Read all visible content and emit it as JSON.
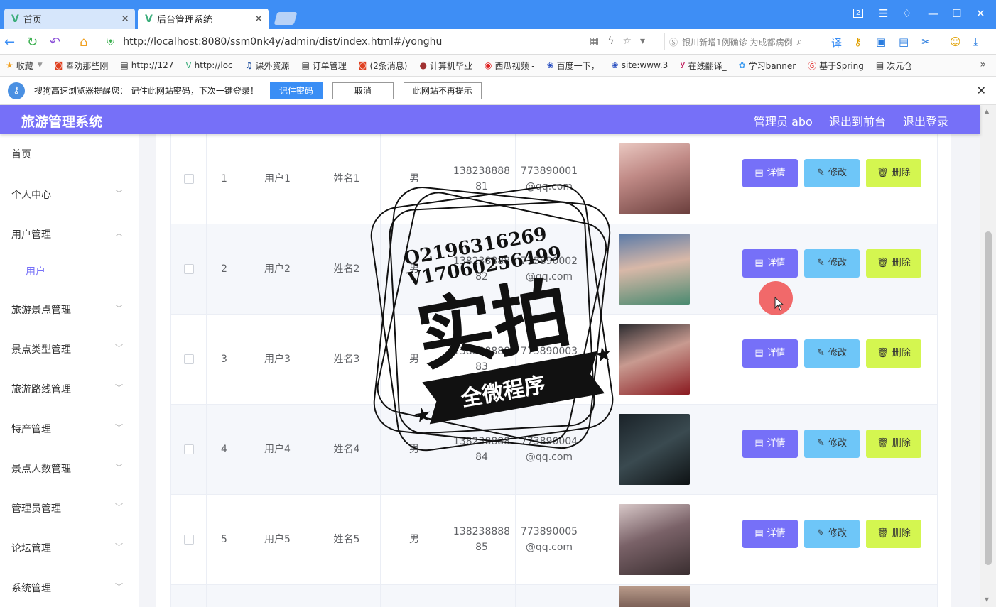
{
  "browser": {
    "tabs": [
      {
        "label": "首页",
        "active": false
      },
      {
        "label": "后台管理系统",
        "active": true
      }
    ],
    "window_badge": "2",
    "url": "http://localhost:8080/ssm0nk4y/admin/dist/index.html#/yonghu",
    "search_text": "银川新增1例确诊 为成都病例",
    "bookmarks": [
      "收藏",
      "奉劝那些刚",
      "http://127",
      "http://loc",
      "课外资源",
      "订单管理",
      "(2条消息)",
      "计算机毕业",
      "西瓜视频 -",
      "百度一下，",
      "site:www.3",
      "在线翻译_",
      "学习banner",
      "基于Spring",
      "次元仓"
    ],
    "password_prompt": {
      "text": "搜狗高速浏览器提醒您： 记住此网站密码，下次一键登录！",
      "remember": "记住密码",
      "cancel": "取消",
      "never": "此网站不再提示"
    }
  },
  "header": {
    "title": "旅游管理系统",
    "admin": "管理员 abo",
    "to_front": "退出到前台",
    "logout": "退出登录",
    "color": "#7670f8"
  },
  "sidebar": {
    "items": [
      {
        "label": "首页"
      },
      {
        "label": "个人中心"
      },
      {
        "label": "用户管理"
      },
      {
        "label": "用户"
      },
      {
        "label": "旅游景点管理"
      },
      {
        "label": "景点类型管理"
      },
      {
        "label": "旅游路线管理"
      },
      {
        "label": "特产管理"
      },
      {
        "label": "景点人数管理"
      },
      {
        "label": "管理员管理"
      },
      {
        "label": "论坛管理"
      },
      {
        "label": "系统管理"
      }
    ]
  },
  "table": {
    "buttons": {
      "detail": "详情",
      "edit": "修改",
      "delete": "删除"
    },
    "rows": [
      {
        "index": "1",
        "account": "用户1",
        "name": "姓名1",
        "sex": "男",
        "phone_a": "138238888",
        "phone_b": "81",
        "mail_a": "773890001",
        "mail_b": "@qq.com"
      },
      {
        "index": "2",
        "account": "用户2",
        "name": "姓名2",
        "sex": "男",
        "phone_a": "138238888",
        "phone_b": "82",
        "mail_a": "773890002",
        "mail_b": "@qq.com"
      },
      {
        "index": "3",
        "account": "用户3",
        "name": "姓名3",
        "sex": "男",
        "phone_a": "138238888",
        "phone_b": "83",
        "mail_a": "773890003",
        "mail_b": "@qq.com"
      },
      {
        "index": "4",
        "account": "用户4",
        "name": "姓名4",
        "sex": "男",
        "phone_a": "138238888",
        "phone_b": "84",
        "mail_a": "773890004",
        "mail_b": "@qq.com"
      },
      {
        "index": "5",
        "account": "用户5",
        "name": "姓名5",
        "sex": "男",
        "phone_a": "138238888",
        "phone_b": "85",
        "mail_a": "773890005",
        "mail_b": "@qq.com"
      }
    ]
  },
  "watermark": {
    "line1": "Q2196316269",
    "line2": "V17060256499",
    "main": "实拍",
    "banner": "全微程序"
  }
}
